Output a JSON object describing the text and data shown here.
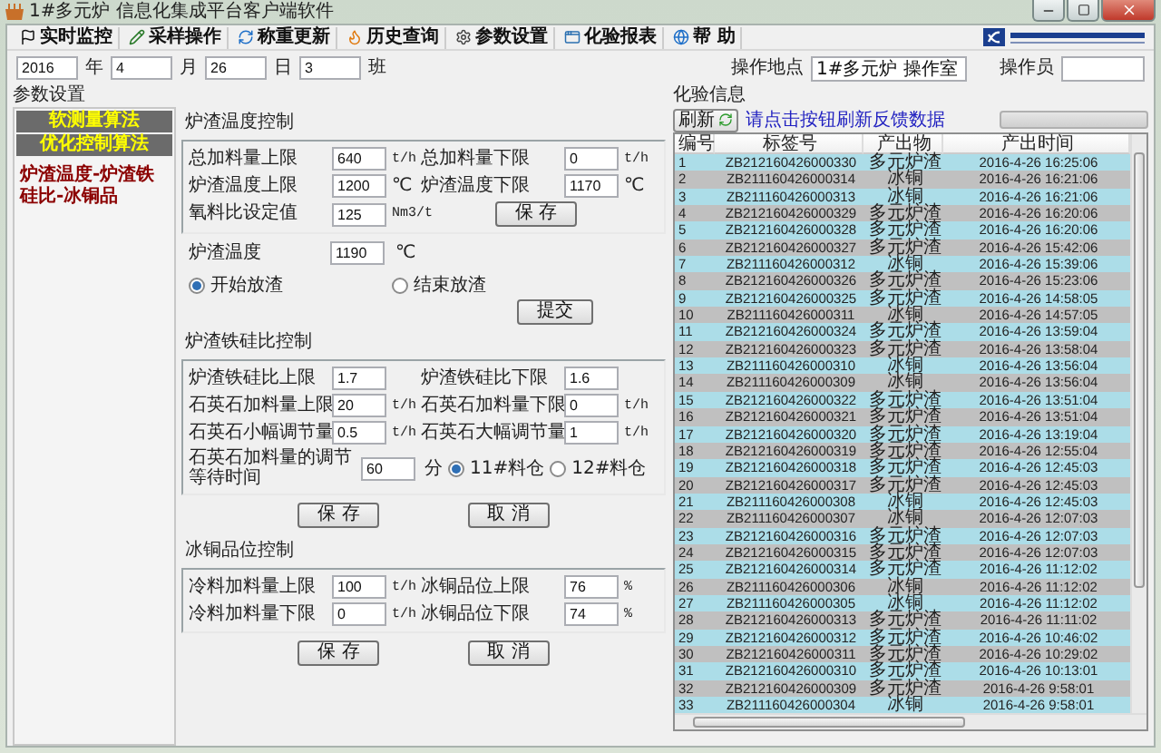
{
  "window": {
    "title": "1#多元炉 信息化集成平台客户端软件"
  },
  "toolbar": [
    {
      "label": "实时监控",
      "kind": "monitor"
    },
    {
      "label": "采样操作",
      "kind": "sample"
    },
    {
      "label": "称重更新",
      "kind": "weigh"
    },
    {
      "label": "历史查询",
      "kind": "history"
    },
    {
      "label": "参数设置",
      "kind": "settings"
    },
    {
      "label": "化验报表",
      "kind": "report"
    },
    {
      "label": "帮 助",
      "kind": "help"
    }
  ],
  "date_bar": {
    "year": "2016",
    "year_label": "年",
    "month": "4",
    "month_label": "月",
    "day": "26",
    "day_label": "日",
    "shift": "3",
    "shift_label": "班",
    "location_label": "操作地点",
    "location": "1#多元炉 操作室",
    "operator_label": "操作员"
  },
  "parameters": {
    "title": "参数设置",
    "nav": [
      {
        "label": "软测量算法",
        "kind": "header"
      },
      {
        "label": "优化控制算法",
        "kind": "header"
      },
      {
        "label": "炉渣温度-炉渣铁硅比-冰铜品",
        "kind": "item"
      }
    ],
    "sections": [
      {
        "title": "炉渣温度控制",
        "fields": [
          {
            "label": "总加料量上限",
            "value": "640",
            "unit": "t/h"
          },
          {
            "label": "总加料量下限",
            "value": "0",
            "unit": "t/h"
          },
          {
            "label": "炉渣温度上限",
            "value": "1200",
            "unit": "℃"
          },
          {
            "label": "炉渣温度下限",
            "value": "1170",
            "unit": "℃"
          },
          {
            "label": "氧料比设定值",
            "value": "125",
            "unit": "Nm3/t"
          }
        ],
        "save": "保 存",
        "temperature": {
          "label": "炉渣温度",
          "value": "1190",
          "unit": "℃"
        },
        "radios": [
          {
            "label": "开始放渣",
            "selected": true
          },
          {
            "label": "结束放渣",
            "selected": false
          }
        ],
        "submit": "提交"
      },
      {
        "title": "炉渣铁硅比控制",
        "fields": [
          {
            "label": "炉渣铁硅比上限",
            "value": "1.7"
          },
          {
            "label": "炉渣铁硅比下限",
            "value": "1.6"
          },
          {
            "label": "石英石加料量上限",
            "value": "20",
            "unit": "t/h"
          },
          {
            "label": "石英石加料量下限",
            "value": "0",
            "unit": "t/h"
          },
          {
            "label": "石英石小幅调节量",
            "value": "0.5",
            "unit": "t/h"
          },
          {
            "label": "石英石大幅调节量",
            "value": "1",
            "unit": "t/h"
          }
        ],
        "wait": {
          "label": "石英石加料量的调节等待时间",
          "value": "60",
          "unit": "分"
        },
        "radios": [
          {
            "label": "11#料仓",
            "selected": true
          },
          {
            "label": "12#料仓",
            "selected": false
          }
        ],
        "buttons": [
          "保 存",
          "取 消"
        ]
      },
      {
        "title": "冰铜品位控制",
        "fields": [
          {
            "label": "冷料加料量上限",
            "value": "100",
            "unit": "t/h"
          },
          {
            "label": "冰铜品位上限",
            "value": "76",
            "unit": "%"
          },
          {
            "label": "冷料加料量下限",
            "value": "0",
            "unit": "t/h"
          },
          {
            "label": "冰铜品位下限",
            "value": "74",
            "unit": "%"
          }
        ],
        "buttons": [
          "保 存",
          "取 消"
        ]
      }
    ]
  },
  "lab": {
    "title": "化验信息",
    "refresh": "刷新",
    "hint": "请点击按钮刷新反馈数据",
    "progress": {
      "level": 0
    },
    "columns": [
      "编号",
      "标签号",
      "产出物",
      "产出时间"
    ],
    "rows": [
      [
        "1",
        "ZB212160426000330",
        "多元炉渣",
        "2016-4-26 16:25:06"
      ],
      [
        "2",
        "ZB211160426000314",
        "冰铜",
        "2016-4-26 16:21:06"
      ],
      [
        "3",
        "ZB211160426000313",
        "冰铜",
        "2016-4-26 16:21:06"
      ],
      [
        "4",
        "ZB212160426000329",
        "多元炉渣",
        "2016-4-26 16:20:06"
      ],
      [
        "5",
        "ZB212160426000328",
        "多元炉渣",
        "2016-4-26 16:20:06"
      ],
      [
        "6",
        "ZB212160426000327",
        "多元炉渣",
        "2016-4-26 15:42:06"
      ],
      [
        "7",
        "ZB211160426000312",
        "冰铜",
        "2016-4-26 15:39:06"
      ],
      [
        "8",
        "ZB212160426000326",
        "多元炉渣",
        "2016-4-26 15:23:06"
      ],
      [
        "9",
        "ZB212160426000325",
        "多元炉渣",
        "2016-4-26 14:58:05"
      ],
      [
        "10",
        "ZB211160426000311",
        "冰铜",
        "2016-4-26 14:57:05"
      ],
      [
        "11",
        "ZB212160426000324",
        "多元炉渣",
        "2016-4-26 13:59:04"
      ],
      [
        "12",
        "ZB212160426000323",
        "多元炉渣",
        "2016-4-26 13:58:04"
      ],
      [
        "13",
        "ZB211160426000310",
        "冰铜",
        "2016-4-26 13:56:04"
      ],
      [
        "14",
        "ZB211160426000309",
        "冰铜",
        "2016-4-26 13:56:04"
      ],
      [
        "15",
        "ZB212160426000322",
        "多元炉渣",
        "2016-4-26 13:51:04"
      ],
      [
        "16",
        "ZB212160426000321",
        "多元炉渣",
        "2016-4-26 13:51:04"
      ],
      [
        "17",
        "ZB212160426000320",
        "多元炉渣",
        "2016-4-26 13:19:04"
      ],
      [
        "18",
        "ZB212160426000319",
        "多元炉渣",
        "2016-4-26 12:55:04"
      ],
      [
        "19",
        "ZB212160426000318",
        "多元炉渣",
        "2016-4-26 12:45:03"
      ],
      [
        "20",
        "ZB212160426000317",
        "多元炉渣",
        "2016-4-26 12:45:03"
      ],
      [
        "21",
        "ZB211160426000308",
        "冰铜",
        "2016-4-26 12:45:03"
      ],
      [
        "22",
        "ZB211160426000307",
        "冰铜",
        "2016-4-26 12:07:03"
      ],
      [
        "23",
        "ZB212160426000316",
        "多元炉渣",
        "2016-4-26 12:07:03"
      ],
      [
        "24",
        "ZB212160426000315",
        "多元炉渣",
        "2016-4-26 12:07:03"
      ],
      [
        "25",
        "ZB212160426000314",
        "多元炉渣",
        "2016-4-26 11:12:02"
      ],
      [
        "26",
        "ZB211160426000306",
        "冰铜",
        "2016-4-26 11:12:02"
      ],
      [
        "27",
        "ZB211160426000305",
        "冰铜",
        "2016-4-26 11:12:02"
      ],
      [
        "28",
        "ZB212160426000313",
        "多元炉渣",
        "2016-4-26 11:11:02"
      ],
      [
        "29",
        "ZB212160426000312",
        "多元炉渣",
        "2016-4-26 10:46:02"
      ],
      [
        "30",
        "ZB212160426000311",
        "多元炉渣",
        "2016-4-26 10:29:02"
      ],
      [
        "31",
        "ZB212160426000310",
        "多元炉渣",
        "2016-4-26 10:13:01"
      ],
      [
        "32",
        "ZB212160426000309",
        "多元炉渣",
        "2016-4-26 9:58:01"
      ],
      [
        "33",
        "ZB211160426000304",
        "冰铜",
        "2016-4-26 9:58:01"
      ]
    ]
  }
}
